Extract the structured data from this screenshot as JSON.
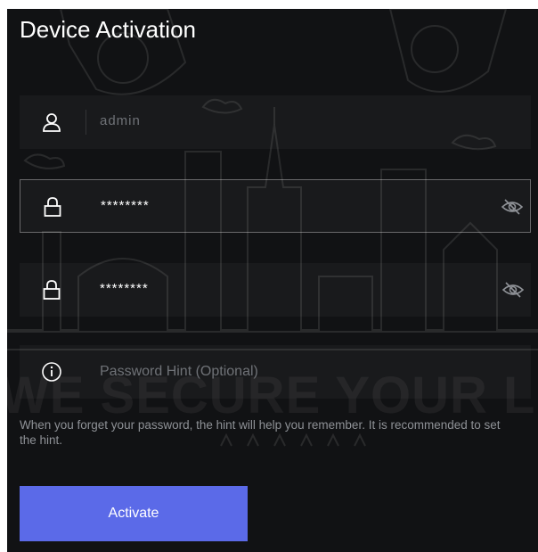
{
  "title": "Device Activation",
  "fields": {
    "username": {
      "value": "admin",
      "icon": "user-icon"
    },
    "password": {
      "value": "********",
      "icon": "lock-icon",
      "toggle_icon": "eye-slash-icon"
    },
    "confirm_password": {
      "value": "********",
      "icon": "lock-icon",
      "toggle_icon": "eye-slash-icon"
    },
    "hint": {
      "placeholder": "Password Hint (Optional)",
      "icon": "info-circle-icon"
    }
  },
  "hint_text": "When you forget your password, the hint will help you remember. It is recommended to set the hint.",
  "background_slogan": "WE SECURE YOUR LIFE",
  "activate_label": "Activate",
  "colors": {
    "panel_bg": "#111214",
    "accent": "#5b6ae8",
    "text": "#ffffff",
    "muted_text": "#8e9196"
  }
}
